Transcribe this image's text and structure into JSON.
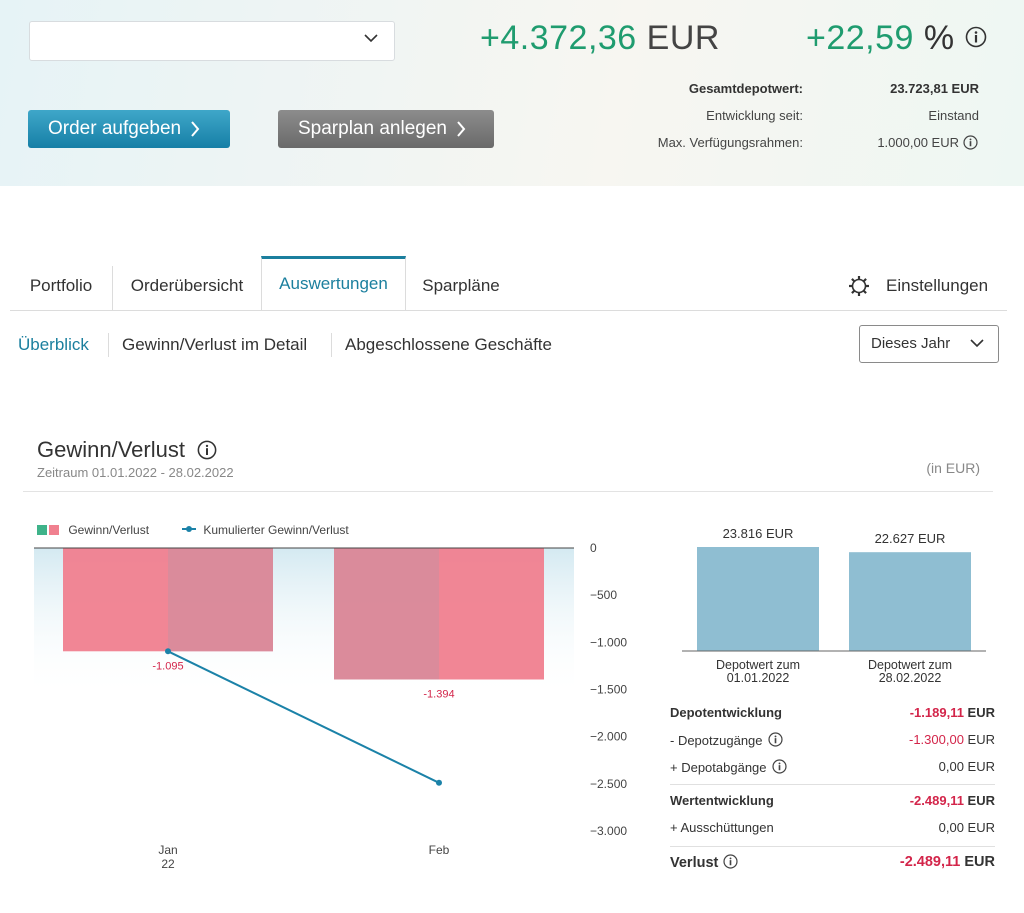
{
  "header": {
    "account_select_value": "",
    "order_button": "Order aufgeben",
    "sparplan_button": "Sparplan anlegen",
    "gain_abs": "+4.372,36",
    "gain_currency": "EUR",
    "gain_pct": "+22,59",
    "pct_sign": "%",
    "rows": [
      {
        "label": "Gesamtdepotwert:",
        "value": "23.723,81 EUR"
      },
      {
        "label": "Entwicklung seit:",
        "value": "Einstand"
      },
      {
        "label": "Max. Verfügungsrahmen:",
        "value": "1.000,00 EUR"
      }
    ],
    "colors": {
      "positive": "#1f9c6f",
      "primary_button": "#1f8db5",
      "secondary_button": "#7a7a7a"
    }
  },
  "tabs": {
    "items": [
      "Portfolio",
      "Orderübersicht",
      "Auswertungen",
      "Sparpläne"
    ],
    "active": "Auswertungen",
    "settings": "Einstellungen"
  },
  "subtabs": {
    "items": [
      "Überblick",
      "Gewinn/Verlust im Detail",
      "Abgeschlossene Geschäfte"
    ],
    "active": "Überblick",
    "period": "Dieses Jahr"
  },
  "section": {
    "title": "Gewinn/Verlust",
    "period": "Zeitraum 01.01.2022 - 28.02.2022",
    "unit": "(in EUR)"
  },
  "chart_data": [
    {
      "type": "bar",
      "legend": [
        "Gewinn/Verlust",
        "Kumulierter Gewinn/Verlust"
      ],
      "categories": [
        "Jan\n22",
        "Feb"
      ],
      "series": [
        {
          "name": "Gewinn/Verlust",
          "values": [
            -1095,
            -1394
          ],
          "labels": [
            "-1.095",
            "-1.394"
          ]
        },
        {
          "name": "Kumulierter Gewinn/Verlust",
          "values": [
            -1095,
            -2489
          ]
        }
      ],
      "yticks": [
        "0",
        "−500",
        "−1.000",
        "−1.500",
        "−2.000",
        "−2.500",
        "−3.000"
      ],
      "ylim": [
        -3000,
        0
      ],
      "colors": {
        "bar": "#f0808f",
        "line": "#1b82a8"
      }
    },
    {
      "type": "bar",
      "categories": [
        "Depotwert zum\n01.01.2022",
        "Depotwert zum\n28.02.2022"
      ],
      "values": [
        23816,
        22627
      ],
      "labels": [
        "23.816 EUR",
        "22.627 EUR"
      ],
      "colors": {
        "bar": "#8fbed2"
      }
    }
  ],
  "summary": [
    {
      "label": "Depotentwicklung",
      "value": "-1.189,11",
      "unit": "EUR",
      "bold": true,
      "neg": true,
      "info": false
    },
    {
      "label": "- Depotzugänge",
      "value": "-1.300,00",
      "unit": "EUR",
      "bold": false,
      "neg": true,
      "info": true
    },
    {
      "label": "+ Depotabgänge",
      "value": "0,00",
      "unit": "EUR",
      "bold": false,
      "neg": false,
      "info": true
    },
    {
      "label": "Wertentwicklung",
      "value": "-2.489,11",
      "unit": "EUR",
      "bold": true,
      "neg": true,
      "info": false
    },
    {
      "label": "+ Ausschüttungen",
      "value": "0,00",
      "unit": "EUR",
      "bold": false,
      "neg": false,
      "info": false
    },
    {
      "label": "Verlust",
      "value": "-2.489,11",
      "unit": "EUR",
      "bold": true,
      "neg": true,
      "info": true
    }
  ]
}
